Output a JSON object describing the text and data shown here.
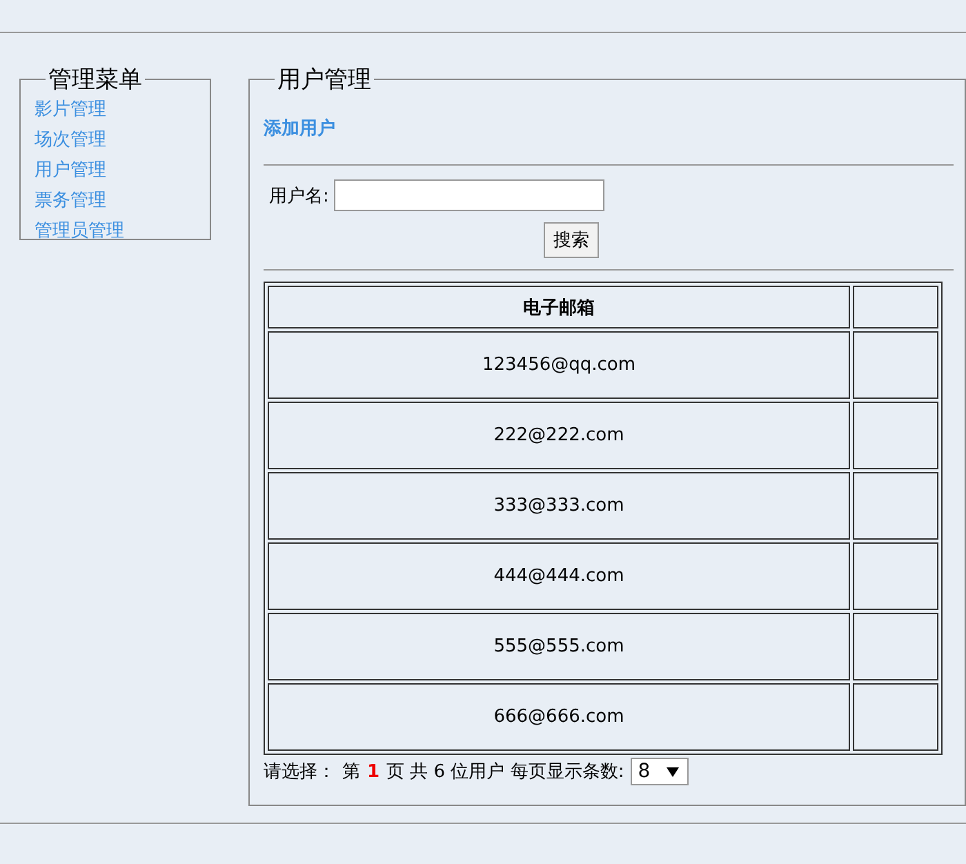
{
  "menu": {
    "title": "管理菜单",
    "items": [
      "影片管理",
      "场次管理",
      "用户管理",
      "票务管理",
      "管理员管理"
    ]
  },
  "panel": {
    "title": "用户管理",
    "add_link": "添加用户",
    "search": {
      "label": "用户名:",
      "button": "搜索"
    },
    "table": {
      "columns": [
        "电子邮箱"
      ],
      "rows": [
        [
          "123456@qq.com"
        ],
        [
          "222@222.com"
        ],
        [
          "333@333.com"
        ],
        [
          "444@444.com"
        ],
        [
          "555@555.com"
        ],
        [
          "666@666.com"
        ]
      ]
    },
    "pagination": {
      "prompt": "请选择：",
      "page_prefix": "第",
      "page": "1",
      "summary": "页 共 6 位用户 每页显示条数:",
      "page_size": "8"
    }
  }
}
